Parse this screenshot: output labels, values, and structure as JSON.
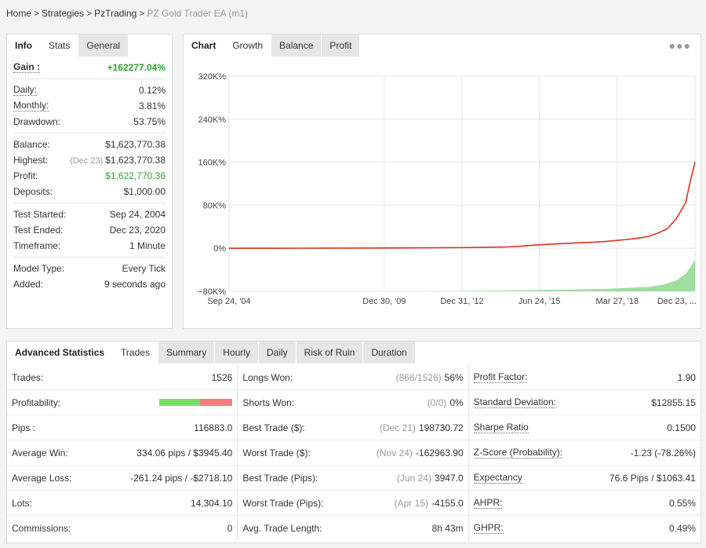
{
  "breadcrumb": {
    "items": [
      "Home",
      "Strategies",
      "PzTrading"
    ],
    "current": "PZ Gold Trader EA (m1)"
  },
  "info": {
    "tabs": [
      "Info",
      "Stats",
      "General"
    ],
    "gain": {
      "label": "Gain :",
      "value": "+162277.04%"
    },
    "daily": {
      "label": "Daily:",
      "value": "0.12%"
    },
    "monthly": {
      "label": "Monthly:",
      "value": "3.81%"
    },
    "drawdown": {
      "label": "Drawdown:",
      "value": "53.75%"
    },
    "balance": {
      "label": "Balance:",
      "value": "$1,623,770.38"
    },
    "highest": {
      "label": "Highest:",
      "note": "(Dec 23)",
      "value": "$1,623,770.38"
    },
    "profit": {
      "label": "Profit:",
      "value": "$1,622,770.36"
    },
    "deposits": {
      "label": "Deposits:",
      "value": "$1,000.00"
    },
    "test_started": {
      "label": "Test Started:",
      "value": "Sep 24, 2004"
    },
    "test_ended": {
      "label": "Test Ended:",
      "value": "Dec 23, 2020"
    },
    "timeframe": {
      "label": "Timeframe:",
      "value": "1 Minute"
    },
    "model_type": {
      "label": "Model Type:",
      "value": "Every Tick"
    },
    "added": {
      "label": "Added:",
      "value": "9 seconds ago"
    }
  },
  "chart_panel": {
    "tabs": [
      "Chart",
      "Growth",
      "Balance",
      "Profit"
    ],
    "menu_icon": "more-dots-icon"
  },
  "chart_data": {
    "type": "line",
    "y_tick_labels": [
      "320K%",
      "240K%",
      "160K%",
      "80K%",
      "0%",
      "−80K%"
    ],
    "y_ticks": [
      320000,
      240000,
      160000,
      80000,
      0,
      -80000
    ],
    "ylim": [
      -80000,
      320000
    ],
    "x_tick_labels": [
      "Sep 24, '04",
      "Dec 30, '09",
      "Dec 31, '12",
      "Jun 24, '15",
      "Mar 27, '18",
      "Dec 23, ..."
    ],
    "x_ticks": [
      0.0,
      0.333,
      0.5,
      0.666,
      0.833,
      1.0
    ],
    "grid": true,
    "series": [
      {
        "color": "#e03020",
        "x": [
          0.0,
          0.1,
          0.2,
          0.3,
          0.4,
          0.5,
          0.55,
          0.6,
          0.63,
          0.66,
          0.7,
          0.75,
          0.8,
          0.85,
          0.88,
          0.9,
          0.92,
          0.94,
          0.96,
          0.97,
          0.98,
          0.99,
          1.0
        ],
        "values": [
          0,
          50,
          200,
          400,
          700,
          1200,
          1600,
          2500,
          4000,
          6000,
          8000,
          10000,
          12000,
          16000,
          19000,
          22000,
          28000,
          36000,
          55000,
          70000,
          85000,
          125000,
          160000
        ]
      },
      {
        "color": "#8dd88d",
        "type": "area",
        "x": [
          0.4,
          0.5,
          0.6,
          0.7,
          0.8,
          0.85,
          0.9,
          0.93,
          0.96,
          0.98,
          1.0
        ],
        "values": [
          -80000,
          -79500,
          -78500,
          -77000,
          -76000,
          -74000,
          -72000,
          -68000,
          -60000,
          -48000,
          -22000
        ]
      }
    ]
  },
  "advanced": {
    "tabs": [
      "Advanced Statistics",
      "Trades",
      "Summary",
      "Hourly",
      "Daily",
      "Risk of Ruin",
      "Duration"
    ],
    "col1": [
      {
        "label": "Trades:",
        "value": "1526"
      },
      {
        "label": "Profitability:",
        "win_fraction": 0.56
      },
      {
        "label": "Pips :",
        "value": "116883.0"
      },
      {
        "label": "Average Win:",
        "value": "334.06 pips / $3945.40"
      },
      {
        "label": "Average Loss:",
        "value": "-261.24 pips / -$2718.10"
      },
      {
        "label": "Lots:",
        "value": "14,304.10"
      },
      {
        "label": "Commissions:",
        "value": "0"
      }
    ],
    "col2": [
      {
        "label": "Longs Won:",
        "note": "(866/1526)",
        "value": "56%"
      },
      {
        "label": "Shorts Won:",
        "note": "(0/0)",
        "value": "0%"
      },
      {
        "label": "Best Trade ($):",
        "note": "(Dec 21)",
        "value": "198730.72"
      },
      {
        "label": "Worst Trade ($):",
        "note": "(Nov 24)",
        "value": "-162963.90"
      },
      {
        "label": "Best Trade (Pips):",
        "note": "(Jun 24)",
        "value": "3947.0"
      },
      {
        "label": "Worst Trade (Pips):",
        "note": "(Apr 15)",
        "value": "-4155.0"
      },
      {
        "label": "Avg. Trade Length:",
        "value": "8h 43m"
      }
    ],
    "col3": [
      {
        "label": "Profit Factor:",
        "value": "1.90"
      },
      {
        "label": "Standard Deviation:",
        "value": "$12855.15"
      },
      {
        "label": "Sharpe Ratio",
        "value": "0.1500"
      },
      {
        "label": "Z-Score (Probability):",
        "value": "-1.23 (-78.26%)"
      },
      {
        "label": "Expectancy",
        "value": "76.6 Pips / $1063.41"
      },
      {
        "label": "AHPR:",
        "value": "0.55%"
      },
      {
        "label": "GHPR:",
        "value": "0.49%"
      }
    ]
  }
}
